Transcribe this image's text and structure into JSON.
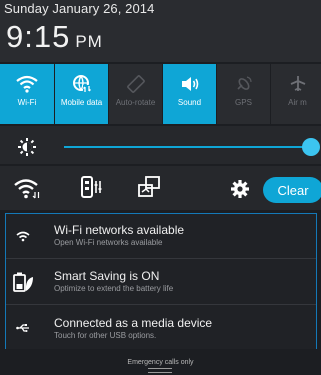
{
  "status": {
    "date": "Sunday January 26, 2014",
    "time": "9:15",
    "ampm": "PM"
  },
  "quick_settings": [
    {
      "label": "Wi-Fi",
      "icon": "wifi-icon",
      "active": true
    },
    {
      "label": "Mobile data",
      "icon": "mobile-data-icon",
      "active": true
    },
    {
      "label": "Auto-rotate",
      "icon": "auto-rotate-icon",
      "active": false
    },
    {
      "label": "Sound",
      "icon": "sound-icon",
      "active": true
    },
    {
      "label": "GPS",
      "icon": "gps-icon",
      "active": false
    },
    {
      "label": "Air m",
      "icon": "airplane-mode-icon",
      "active": false
    }
  ],
  "brightness": {
    "level": 1.0,
    "icon": "brightness-icon"
  },
  "tools": {
    "clear_label": "Clear"
  },
  "notifications": [
    {
      "icon": "wifi-icon",
      "title": "Wi-Fi networks available",
      "subtitle": "Open Wi-Fi networks available"
    },
    {
      "icon": "battery-leaf-icon",
      "title": "Smart Saving is ON",
      "subtitle": "Optimize to extend the battery life"
    },
    {
      "icon": "usb-icon",
      "title": "Connected as a media device",
      "subtitle": "Touch for other USB options."
    }
  ],
  "footer": {
    "text": "Emergency calls only"
  },
  "colors": {
    "accent": "#0fa6d6",
    "background": "#1c1e22"
  }
}
